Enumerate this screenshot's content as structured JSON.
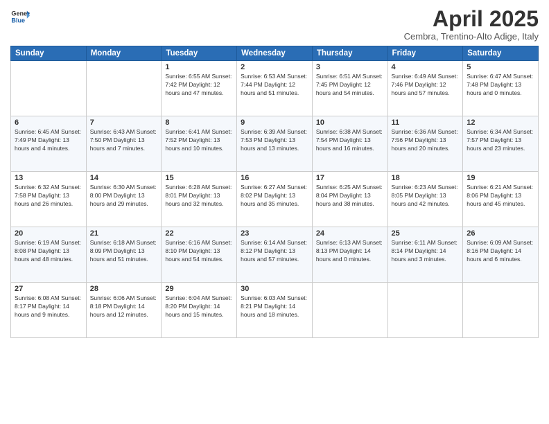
{
  "logo": {
    "line1": "General",
    "line2": "Blue"
  },
  "title": "April 2025",
  "subtitle": "Cembra, Trentino-Alto Adige, Italy",
  "days_of_week": [
    "Sunday",
    "Monday",
    "Tuesday",
    "Wednesday",
    "Thursday",
    "Friday",
    "Saturday"
  ],
  "weeks": [
    [
      {
        "day": "",
        "info": ""
      },
      {
        "day": "",
        "info": ""
      },
      {
        "day": "1",
        "info": "Sunrise: 6:55 AM\nSunset: 7:42 PM\nDaylight: 12 hours and 47 minutes."
      },
      {
        "day": "2",
        "info": "Sunrise: 6:53 AM\nSunset: 7:44 PM\nDaylight: 12 hours and 51 minutes."
      },
      {
        "day": "3",
        "info": "Sunrise: 6:51 AM\nSunset: 7:45 PM\nDaylight: 12 hours and 54 minutes."
      },
      {
        "day": "4",
        "info": "Sunrise: 6:49 AM\nSunset: 7:46 PM\nDaylight: 12 hours and 57 minutes."
      },
      {
        "day": "5",
        "info": "Sunrise: 6:47 AM\nSunset: 7:48 PM\nDaylight: 13 hours and 0 minutes."
      }
    ],
    [
      {
        "day": "6",
        "info": "Sunrise: 6:45 AM\nSunset: 7:49 PM\nDaylight: 13 hours and 4 minutes."
      },
      {
        "day": "7",
        "info": "Sunrise: 6:43 AM\nSunset: 7:50 PM\nDaylight: 13 hours and 7 minutes."
      },
      {
        "day": "8",
        "info": "Sunrise: 6:41 AM\nSunset: 7:52 PM\nDaylight: 13 hours and 10 minutes."
      },
      {
        "day": "9",
        "info": "Sunrise: 6:39 AM\nSunset: 7:53 PM\nDaylight: 13 hours and 13 minutes."
      },
      {
        "day": "10",
        "info": "Sunrise: 6:38 AM\nSunset: 7:54 PM\nDaylight: 13 hours and 16 minutes."
      },
      {
        "day": "11",
        "info": "Sunrise: 6:36 AM\nSunset: 7:56 PM\nDaylight: 13 hours and 20 minutes."
      },
      {
        "day": "12",
        "info": "Sunrise: 6:34 AM\nSunset: 7:57 PM\nDaylight: 13 hours and 23 minutes."
      }
    ],
    [
      {
        "day": "13",
        "info": "Sunrise: 6:32 AM\nSunset: 7:58 PM\nDaylight: 13 hours and 26 minutes."
      },
      {
        "day": "14",
        "info": "Sunrise: 6:30 AM\nSunset: 8:00 PM\nDaylight: 13 hours and 29 minutes."
      },
      {
        "day": "15",
        "info": "Sunrise: 6:28 AM\nSunset: 8:01 PM\nDaylight: 13 hours and 32 minutes."
      },
      {
        "day": "16",
        "info": "Sunrise: 6:27 AM\nSunset: 8:02 PM\nDaylight: 13 hours and 35 minutes."
      },
      {
        "day": "17",
        "info": "Sunrise: 6:25 AM\nSunset: 8:04 PM\nDaylight: 13 hours and 38 minutes."
      },
      {
        "day": "18",
        "info": "Sunrise: 6:23 AM\nSunset: 8:05 PM\nDaylight: 13 hours and 42 minutes."
      },
      {
        "day": "19",
        "info": "Sunrise: 6:21 AM\nSunset: 8:06 PM\nDaylight: 13 hours and 45 minutes."
      }
    ],
    [
      {
        "day": "20",
        "info": "Sunrise: 6:19 AM\nSunset: 8:08 PM\nDaylight: 13 hours and 48 minutes."
      },
      {
        "day": "21",
        "info": "Sunrise: 6:18 AM\nSunset: 8:09 PM\nDaylight: 13 hours and 51 minutes."
      },
      {
        "day": "22",
        "info": "Sunrise: 6:16 AM\nSunset: 8:10 PM\nDaylight: 13 hours and 54 minutes."
      },
      {
        "day": "23",
        "info": "Sunrise: 6:14 AM\nSunset: 8:12 PM\nDaylight: 13 hours and 57 minutes."
      },
      {
        "day": "24",
        "info": "Sunrise: 6:13 AM\nSunset: 8:13 PM\nDaylight: 14 hours and 0 minutes."
      },
      {
        "day": "25",
        "info": "Sunrise: 6:11 AM\nSunset: 8:14 PM\nDaylight: 14 hours and 3 minutes."
      },
      {
        "day": "26",
        "info": "Sunrise: 6:09 AM\nSunset: 8:16 PM\nDaylight: 14 hours and 6 minutes."
      }
    ],
    [
      {
        "day": "27",
        "info": "Sunrise: 6:08 AM\nSunset: 8:17 PM\nDaylight: 14 hours and 9 minutes."
      },
      {
        "day": "28",
        "info": "Sunrise: 6:06 AM\nSunset: 8:18 PM\nDaylight: 14 hours and 12 minutes."
      },
      {
        "day": "29",
        "info": "Sunrise: 6:04 AM\nSunset: 8:20 PM\nDaylight: 14 hours and 15 minutes."
      },
      {
        "day": "30",
        "info": "Sunrise: 6:03 AM\nSunset: 8:21 PM\nDaylight: 14 hours and 18 minutes."
      },
      {
        "day": "",
        "info": ""
      },
      {
        "day": "",
        "info": ""
      },
      {
        "day": "",
        "info": ""
      }
    ]
  ]
}
